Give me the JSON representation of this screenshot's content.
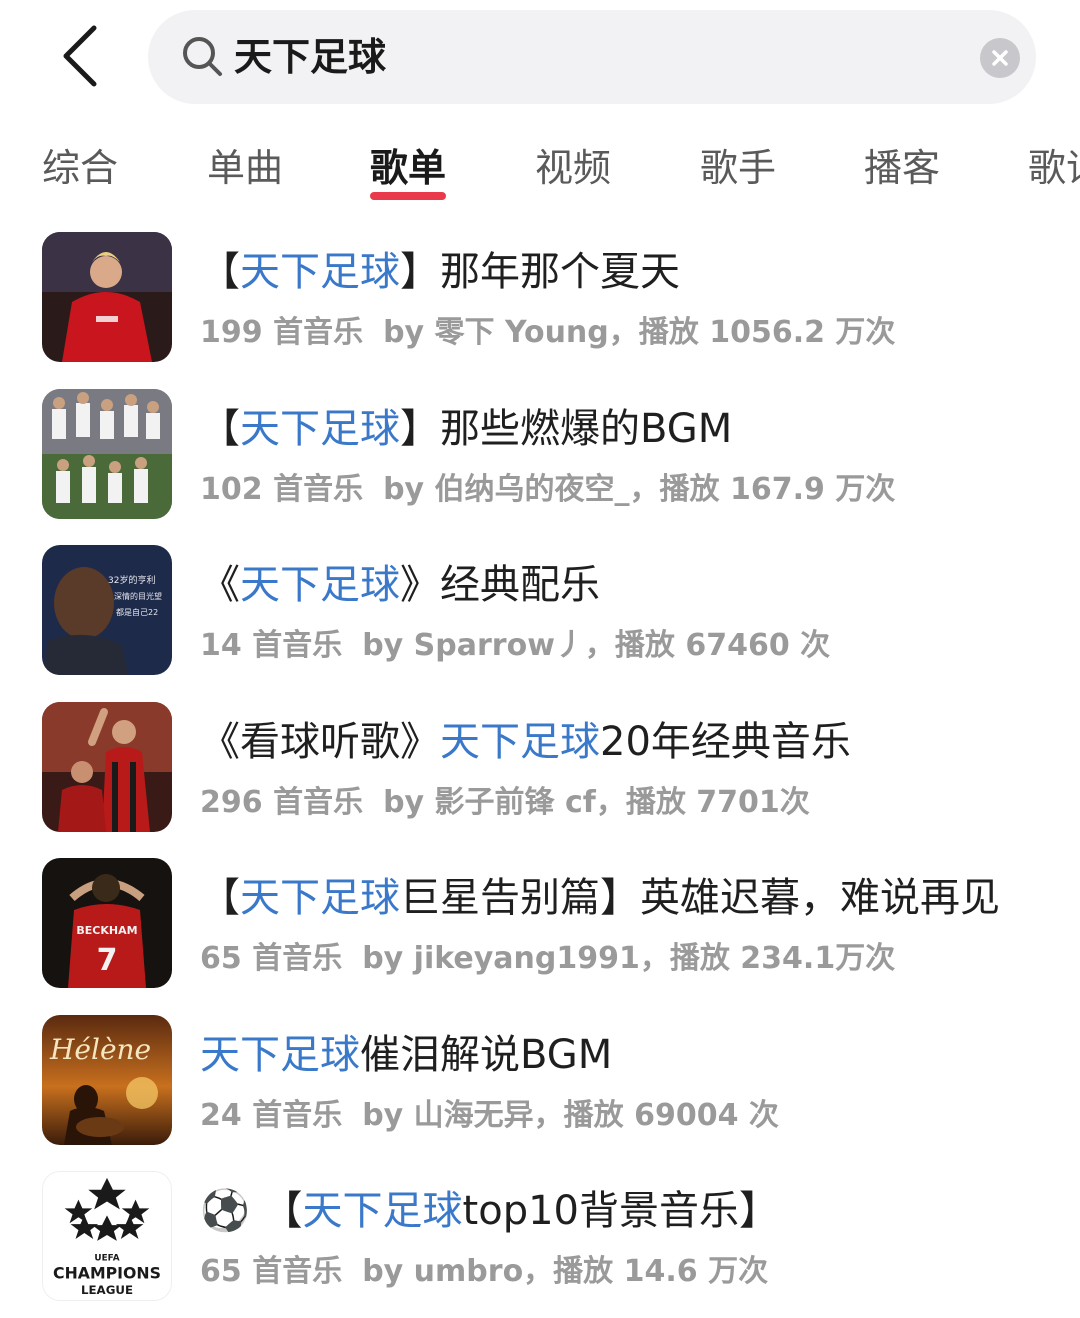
{
  "search": {
    "query": "天下足球"
  },
  "tabs": [
    {
      "label": "综合"
    },
    {
      "label": "单曲"
    },
    {
      "label": "歌单"
    },
    {
      "label": "视频"
    },
    {
      "label": "歌手"
    },
    {
      "label": "播客"
    },
    {
      "label": "歌词"
    }
  ],
  "active_tab": "歌单",
  "playlists": [
    {
      "title_pre": "【",
      "title_hl": "天下足球",
      "title_post": "】那年那个夏天",
      "count": "199 首音乐",
      "by": "by 零下 Young，播放 1056.2 万次",
      "cover_icon": "player-red-jersey-cover"
    },
    {
      "title_pre": "【",
      "title_hl": "天下足球",
      "title_post": "】那些燃爆的BGM",
      "count": "102 首音乐",
      "by": "by 伯纳乌的夜空_，播放 167.9 万次",
      "cover_icon": "team-collage-cover"
    },
    {
      "title_pre": "《",
      "title_hl": "天下足球",
      "title_post": "》经典配乐",
      "count": "14 首音乐",
      "by": "by Sparrow丿，播放 67460 次",
      "cover_icon": "player-portrait-cover",
      "cover_caption": [
        "32岁的亨利",
        "深情的目光望",
        "都是自己22"
      ]
    },
    {
      "title_pre": "《看球听歌》",
      "title_hl": "天下足球",
      "title_post": "20年经典音乐",
      "count": "296 首音乐",
      "by": "by 影子前锋 cf，播放 7701次",
      "cover_icon": "players-celebrating-cover"
    },
    {
      "title_pre": "【",
      "title_hl": "天下足球",
      "title_post": "巨星告别篇】英雄迟暮，难说再见",
      "count": "65 首音乐",
      "by": "by jikeyang1991，播放 234.1万次",
      "cover_icon": "jersey-back-cover",
      "cover_caption": [
        "BECKHAM",
        "7"
      ]
    },
    {
      "title_pre": "",
      "title_hl": "天下足球",
      "title_post": "催泪解说BGM",
      "count": "24 首音乐",
      "by": "by 山海无异，播放 69004 次",
      "cover_icon": "helene-album-cover",
      "cover_caption": [
        "Hélène"
      ]
    },
    {
      "title_pre": "⚽ 【",
      "title_hl": "天下足球",
      "title_post": "top10背景音乐】",
      "count": "65 首音乐",
      "by": "by umbro，播放 14.6 万次",
      "cover_icon": "champions-league-logo-cover",
      "cover_caption": [
        "UEFA",
        "CHAMPIONS",
        "LEAGUE"
      ]
    }
  ],
  "colors": {
    "highlight": "#3a78c9",
    "tab_underline": "#e83a4a"
  }
}
